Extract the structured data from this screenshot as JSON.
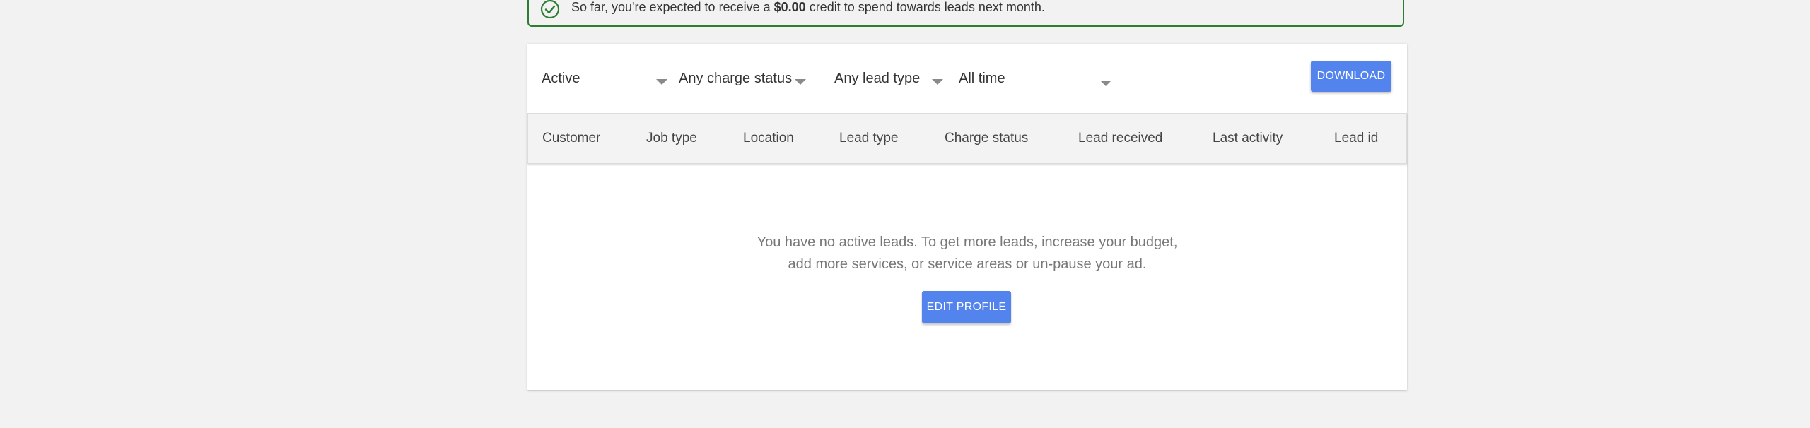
{
  "notice": {
    "prefix": "So far, you're expected to receive a",
    "amount": "$0.00",
    "suffix": "credit to spend towards leads next month.",
    "color": "#2e7d32"
  },
  "filters": {
    "status": "Active",
    "charge_status": "Any charge status",
    "lead_type": "Any lead type",
    "time": "All time"
  },
  "toolbar": {
    "download_label": "DOWNLOAD"
  },
  "table": {
    "columns": [
      "Customer",
      "Job type",
      "Location",
      "Lead type",
      "Charge status",
      "Lead received",
      "Last activity",
      "Lead id"
    ],
    "rows": []
  },
  "empty_state": {
    "line1": "You have no active leads. To get more leads, increase your budget,",
    "line2": "add more services, or service areas or un-pause your ad.",
    "button_label": "EDIT PROFILE"
  },
  "colors": {
    "accent": "#5383ec",
    "background": "#f2f2f2"
  }
}
